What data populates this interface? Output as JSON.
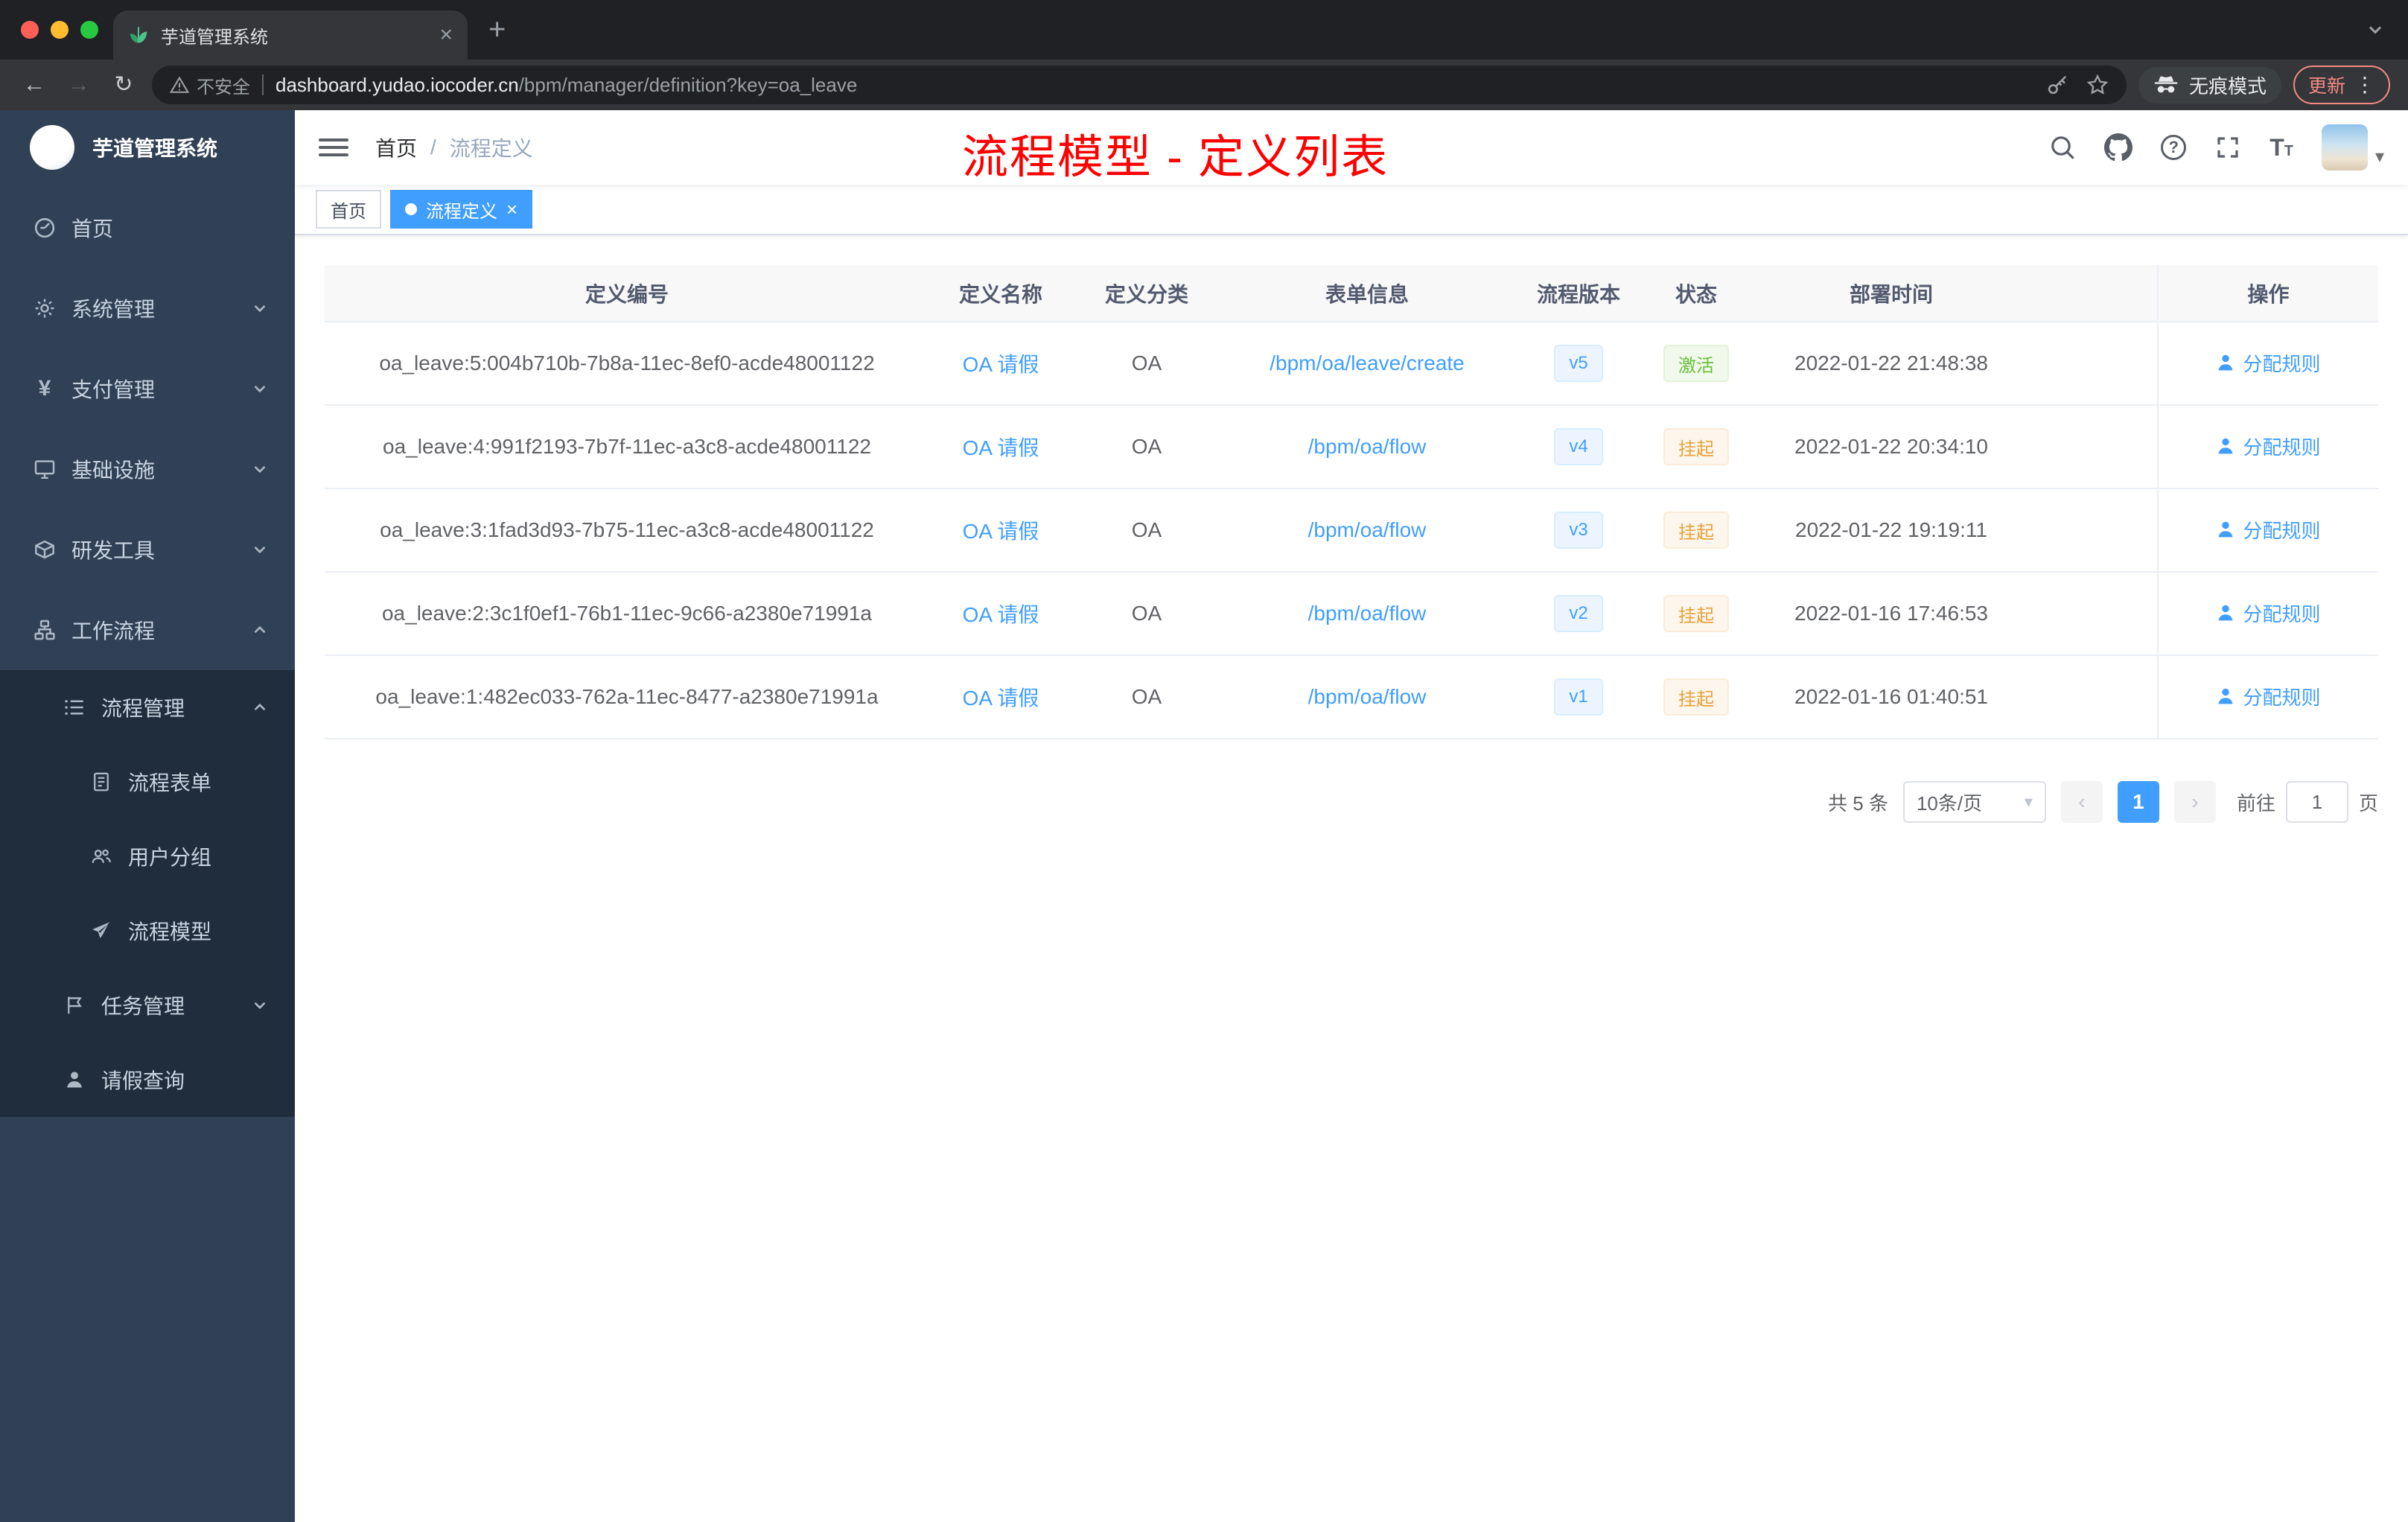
{
  "colors": {
    "accent": "#409eff",
    "success": "#67c23a",
    "warning": "#e6a23c",
    "annotation_red": "#ff0000",
    "sidebar_bg": "#304156",
    "submenu_bg": "#1f2d3d"
  },
  "icons": {
    "back": "←",
    "forward": "→",
    "reload": "↻",
    "new_tab": "+",
    "tab_close": "×",
    "more_vertical": "⋮",
    "caret_down": "▾",
    "chevron_prev": "‹",
    "chevron_next": "›",
    "yen": "¥",
    "question_mark": "?"
  },
  "browser": {
    "tab_title": "芋道管理系统",
    "security_label": "不安全",
    "url_domain": "dashboard.yudao.iocoder.cn",
    "url_path": "/bpm/manager/definition?key=oa_leave",
    "incognito_label": "无痕模式",
    "update_label": "更新"
  },
  "sidebar": {
    "logo_title": "芋道管理系统",
    "items": [
      {
        "label": "首页"
      },
      {
        "label": "系统管理"
      },
      {
        "label": "支付管理"
      },
      {
        "label": "基础设施"
      },
      {
        "label": "研发工具"
      },
      {
        "label": "工作流程"
      },
      {
        "label": "流程管理"
      },
      {
        "label": "流程表单"
      },
      {
        "label": "用户分组"
      },
      {
        "label": "流程模型"
      },
      {
        "label": "任务管理"
      },
      {
        "label": "请假查询"
      }
    ]
  },
  "navbar": {
    "breadcrumb_home": "首页",
    "breadcrumb_separator": "/",
    "breadcrumb_current": "流程定义",
    "annotation": "流程模型 - 定义列表"
  },
  "tags": {
    "home": "首页",
    "active": "流程定义"
  },
  "table": {
    "columns": {
      "id": "定义编号",
      "name": "定义名称",
      "category": "定义分类",
      "form": "表单信息",
      "version": "流程版本",
      "status": "状态",
      "time": "部署时间",
      "actions": "操作"
    },
    "rows": [
      {
        "id": "oa_leave:5:004b710b-7b8a-11ec-8ef0-acde48001122",
        "name": "OA 请假",
        "category": "OA",
        "form": "/bpm/oa/leave/create",
        "version": "v5",
        "status": "激活",
        "time": "2022-01-22 21:48:38",
        "action": "分配规则"
      },
      {
        "id": "oa_leave:4:991f2193-7b7f-11ec-a3c8-acde48001122",
        "name": "OA 请假",
        "category": "OA",
        "form": "/bpm/oa/flow",
        "version": "v4",
        "status": "挂起",
        "time": "2022-01-22 20:34:10",
        "action": "分配规则"
      },
      {
        "id": "oa_leave:3:1fad3d93-7b75-11ec-a3c8-acde48001122",
        "name": "OA 请假",
        "category": "OA",
        "form": "/bpm/oa/flow",
        "version": "v3",
        "status": "挂起",
        "time": "2022-01-22 19:19:11",
        "action": "分配规则"
      },
      {
        "id": "oa_leave:2:3c1f0ef1-76b1-11ec-9c66-a2380e71991a",
        "name": "OA 请假",
        "category": "OA",
        "form": "/bpm/oa/flow",
        "version": "v2",
        "status": "挂起",
        "time": "2022-01-16 17:46:53",
        "action": "分配规则"
      },
      {
        "id": "oa_leave:1:482ec033-762a-11ec-8477-a2380e71991a",
        "name": "OA 请假",
        "category": "OA",
        "form": "/bpm/oa/flow",
        "version": "v1",
        "status": "挂起",
        "time": "2022-01-16 01:40:51",
        "action": "分配规则"
      }
    ]
  },
  "pagination": {
    "total": "共 5 条",
    "page_size": "10条/页",
    "page": "1",
    "goto": "前往",
    "goto_value": "1",
    "unit": "页"
  }
}
